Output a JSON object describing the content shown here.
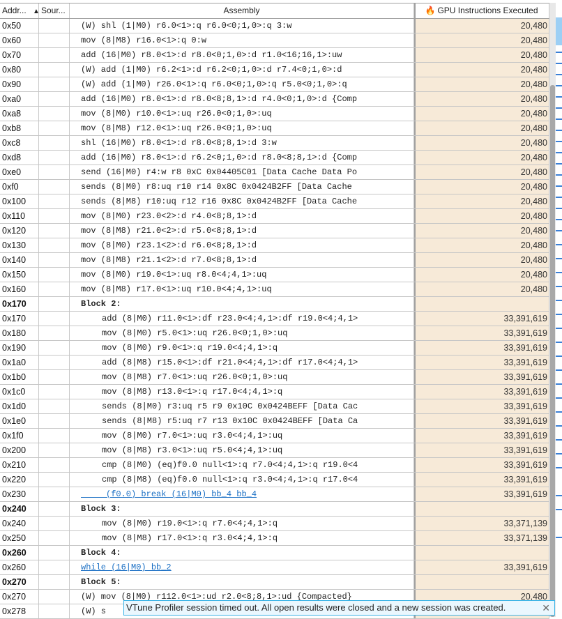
{
  "header": {
    "addr": "Addr...",
    "sort_indicator": "▲",
    "source": "Sour...",
    "assembly": "Assembly",
    "metric": "GPU Instructions Executed",
    "metric_icon": "flame-icon"
  },
  "rows": [
    {
      "addr": "0x50",
      "asm": "(W) shl (1|M0) r6.0<1>:q r6.0<0;1,0>:q 3:w",
      "val": "20,480"
    },
    {
      "addr": "0x60",
      "asm": "mov (8|M8) r16.0<1>:q 0:w",
      "val": "20,480"
    },
    {
      "addr": "0x70",
      "asm": "add (16|M0) r8.0<1>:d r8.0<0;1,0>:d r1.0<16;16,1>:uw",
      "val": "20,480"
    },
    {
      "addr": "0x80",
      "asm": "(W) add (1|M0) r6.2<1>:d r6.2<0;1,0>:d r7.4<0;1,0>:d",
      "val": "20,480"
    },
    {
      "addr": "0x90",
      "asm": "(W) add (1|M0) r26.0<1>:q r6.0<0;1,0>:q r5.0<0;1,0>:q",
      "val": "20,480"
    },
    {
      "addr": "0xa0",
      "asm": "add (16|M0) r8.0<1>:d r8.0<8;8,1>:d r4.0<0;1,0>:d {Comp",
      "val": "20,480"
    },
    {
      "addr": "0xa8",
      "asm": "mov (8|M0) r10.0<1>:uq r26.0<0;1,0>:uq",
      "val": "20,480"
    },
    {
      "addr": "0xb8",
      "asm": "mov (8|M8) r12.0<1>:uq r26.0<0;1,0>:uq",
      "val": "20,480"
    },
    {
      "addr": "0xc8",
      "asm": "shl (16|M0) r8.0<1>:d r8.0<8;8,1>:d 3:w",
      "val": "20,480"
    },
    {
      "addr": "0xd8",
      "asm": "add (16|M0) r8.0<1>:d r6.2<0;1,0>:d r8.0<8;8,1>:d {Comp",
      "val": "20,480"
    },
    {
      "addr": "0xe0",
      "asm": "send (16|M0) r4:w r8 0xC 0x04405C01 [Data Cache Data Po",
      "val": "20,480"
    },
    {
      "addr": "0xf0",
      "asm": "sends (8|M0) r8:uq r10 r14 0x8C 0x0424B2FF [Data Cache",
      "val": "20,480"
    },
    {
      "addr": "0x100",
      "asm": "sends (8|M8) r10:uq r12 r16 0x8C 0x0424B2FF [Data Cache",
      "val": "20,480"
    },
    {
      "addr": "0x110",
      "asm": "mov (8|M0) r23.0<2>:d r4.0<8;8,1>:d",
      "val": "20,480"
    },
    {
      "addr": "0x120",
      "asm": "mov (8|M8) r21.0<2>:d r5.0<8;8,1>:d",
      "val": "20,480"
    },
    {
      "addr": "0x130",
      "asm": "mov (8|M0) r23.1<2>:d r6.0<8;8,1>:d",
      "val": "20,480"
    },
    {
      "addr": "0x140",
      "asm": "mov (8|M8) r21.1<2>:d r7.0<8;8,1>:d",
      "val": "20,480"
    },
    {
      "addr": "0x150",
      "asm": "mov (8|M0) r19.0<1>:uq r8.0<4;4,1>:uq",
      "val": "20,480"
    },
    {
      "addr": "0x160",
      "asm": "mov (8|M8) r17.0<1>:uq r10.0<4;4,1>:uq",
      "val": "20,480"
    },
    {
      "addr": "0x170",
      "asm": "Block 2:",
      "val": "",
      "bold": true
    },
    {
      "addr": "0x170",
      "asm": "add (8|M0) r11.0<1>:df r23.0<4;4,1>:df r19.0<4;4,1>",
      "val": "33,391,619",
      "inner": true
    },
    {
      "addr": "0x180",
      "asm": "mov (8|M0) r5.0<1>:uq r26.0<0;1,0>:uq",
      "val": "33,391,619",
      "inner": true
    },
    {
      "addr": "0x190",
      "asm": "mov (8|M0) r9.0<1>:q r19.0<4;4,1>:q",
      "val": "33,391,619",
      "inner": true
    },
    {
      "addr": "0x1a0",
      "asm": "add (8|M8) r15.0<1>:df r21.0<4;4,1>:df r17.0<4;4,1>",
      "val": "33,391,619",
      "inner": true
    },
    {
      "addr": "0x1b0",
      "asm": "mov (8|M8) r7.0<1>:uq r26.0<0;1,0>:uq",
      "val": "33,391,619",
      "inner": true
    },
    {
      "addr": "0x1c0",
      "asm": "mov (8|M8) r13.0<1>:q r17.0<4;4,1>:q",
      "val": "33,391,619",
      "inner": true
    },
    {
      "addr": "0x1d0",
      "asm": "sends (8|M0) r3:uq r5 r9 0x10C 0x0424BEFF [Data Cac",
      "val": "33,391,619",
      "inner": true
    },
    {
      "addr": "0x1e0",
      "asm": "sends (8|M8) r5:uq r7 r13 0x10C 0x0424BEFF [Data Ca",
      "val": "33,391,619",
      "inner": true
    },
    {
      "addr": "0x1f0",
      "asm": "mov (8|M0) r7.0<1>:uq r3.0<4;4,1>:uq",
      "val": "33,391,619",
      "inner": true
    },
    {
      "addr": "0x200",
      "asm": "mov (8|M8) r3.0<1>:uq r5.0<4;4,1>:uq",
      "val": "33,391,619",
      "inner": true
    },
    {
      "addr": "0x210",
      "asm": "cmp (8|M0) (eq)f0.0 null<1>:q r7.0<4;4,1>:q r19.0<4",
      "val": "33,391,619",
      "inner": true
    },
    {
      "addr": "0x220",
      "asm": "cmp (8|M8) (eq)f0.0 null<1>:q r3.0<4;4,1>:q r17.0<4",
      "val": "33,391,619",
      "inner": true
    },
    {
      "addr": "0x230",
      "asm": "     (f0.0) break (16|M0) bb_4 bb_4",
      "val": "33,391,619",
      "link": true
    },
    {
      "addr": "0x240",
      "asm": "Block 3:",
      "val": "",
      "bold": true
    },
    {
      "addr": "0x240",
      "asm": "mov (8|M0) r19.0<1>:q r7.0<4;4,1>:q",
      "val": "33,371,139",
      "inner": true
    },
    {
      "addr": "0x250",
      "asm": "mov (8|M8) r17.0<1>:q r3.0<4;4,1>:q",
      "val": "33,371,139",
      "inner": true
    },
    {
      "addr": "0x260",
      "asm": "Block 4:",
      "val": "",
      "bold": true
    },
    {
      "addr": "0x260",
      "asm": "while (16|M0) bb_2",
      "val": "33,391,619",
      "link": true
    },
    {
      "addr": "0x270",
      "asm": "Block 5:",
      "val": "",
      "bold": true
    },
    {
      "addr": "0x270",
      "asm": "(W) mov (8|M0) r112.0<1>:ud r2.0<8;8,1>:ud {Compacted}",
      "val": "20,480"
    },
    {
      "addr": "0x278",
      "asm": "(W) s",
      "val": ""
    }
  ],
  "toast": {
    "message": "VTune Profiler session timed out. All open results were closed and a new session was created.",
    "close": "✕"
  },
  "colors": {
    "metric_bg": "#f7ead8",
    "link": "#1a6fc4",
    "toast_border": "#39b3e6"
  }
}
